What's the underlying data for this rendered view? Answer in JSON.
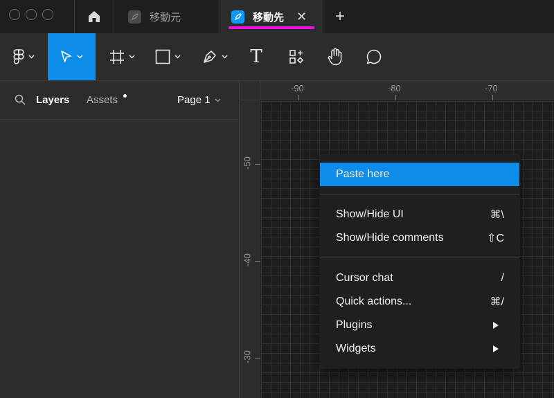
{
  "tabs": {
    "inactive": {
      "label": "移動元",
      "icon": "figma-file-icon"
    },
    "active": {
      "label": "移動先",
      "icon": "figma-file-icon",
      "close": "✕"
    },
    "new_tab": "+"
  },
  "toolbar": {
    "tools": [
      "main-menu",
      "move",
      "frame",
      "shape",
      "pen",
      "text",
      "resources",
      "hand",
      "comment"
    ],
    "text_tool_glyph": "T",
    "active_color": "#0d8ce9"
  },
  "panel": {
    "tab_layers": "Layers",
    "tab_assets": "Assets",
    "page_selector": "Page 1"
  },
  "rulers": {
    "x_labels": [
      "-90",
      "-80",
      "-70"
    ],
    "y_labels": [
      "-50",
      "-40",
      "-30"
    ]
  },
  "context_menu": {
    "items": [
      {
        "label": "Paste here",
        "shortcut": ""
      },
      {
        "label": "Show/Hide UI",
        "shortcut": "⌘\\"
      },
      {
        "label": "Show/Hide comments",
        "shortcut": "⇧C"
      },
      {
        "label": "Cursor chat",
        "shortcut": "/"
      },
      {
        "label": "Quick actions...",
        "shortcut": "⌘/"
      },
      {
        "label": "Plugins",
        "shortcut": ""
      },
      {
        "label": "Widgets",
        "shortcut": ""
      }
    ]
  },
  "colors": {
    "accent": "#0d8ce9",
    "tab_underline": "#ee0ee0",
    "background": "#2c2c2c",
    "canvas": "#1e1e1e"
  }
}
